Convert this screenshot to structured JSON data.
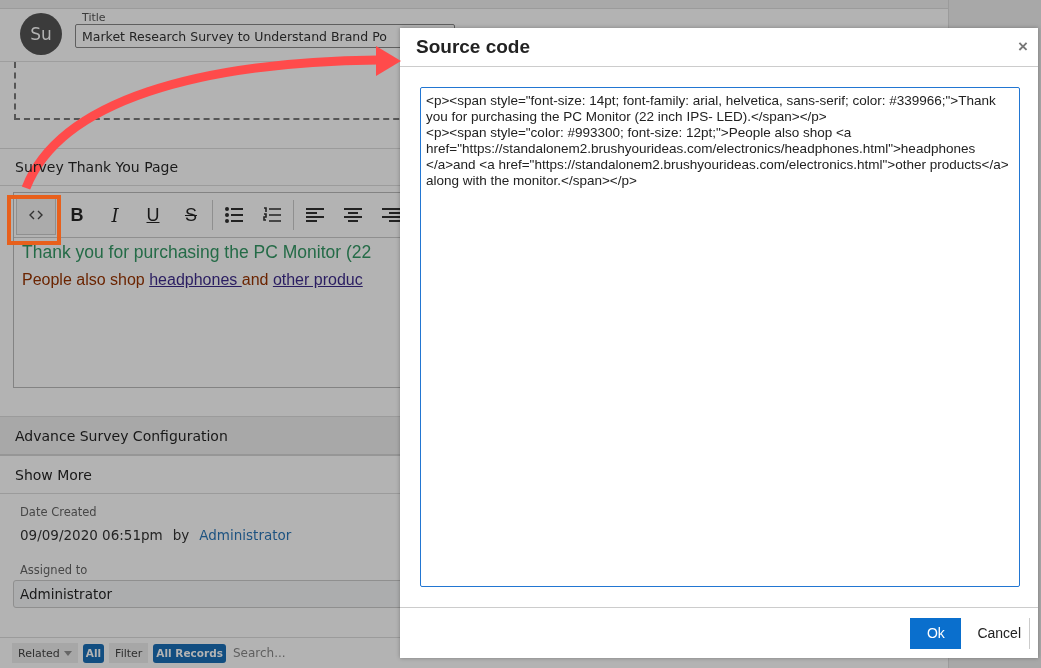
{
  "record": {
    "avatar": "Su",
    "title_label": "Title",
    "title_value": "Market Research Survey to Understand Brand Po"
  },
  "thank_you_section": {
    "heading": "Survey Thank You Page",
    "toolbar": [
      {
        "kind": "code",
        "selected": true
      },
      {
        "kind": "bold",
        "label": "B"
      },
      {
        "kind": "italic",
        "label": "I"
      },
      {
        "kind": "underline",
        "label": "U"
      },
      {
        "kind": "strike",
        "label": "S"
      },
      {
        "kind": "bullets"
      },
      {
        "kind": "numbers"
      },
      {
        "kind": "align-left"
      },
      {
        "kind": "align-center"
      },
      {
        "kind": "align-right"
      }
    ],
    "paragraphs": [
      {
        "color": "#246b47",
        "parts": [
          {
            "text": "Thank you for purchasing the PC Monitor (22",
            "kind": "text"
          }
        ]
      },
      {
        "color": "#6b2400",
        "parts": [
          {
            "text": "People also shop ",
            "kind": "text"
          },
          {
            "text": "headphones ",
            "kind": "link"
          },
          {
            "text": "and ",
            "kind": "text"
          },
          {
            "text": "other produc",
            "kind": "link"
          }
        ]
      }
    ]
  },
  "sections": [
    "Advance Survey Configuration",
    "Show More"
  ],
  "details": {
    "date_label": "Date Created",
    "date_value": "09/09/2020 06:51pm",
    "by": "by",
    "creator": "Administrator",
    "assigned_label": "Assigned to",
    "assigned_value": "Administrator"
  },
  "bottom_bar": {
    "related": "Related",
    "all": "All",
    "filter": "Filter",
    "all_records": "All Records",
    "search_placeholder": "Search..."
  },
  "dialog": {
    "title": "Source code",
    "close": "×",
    "code": "<p><span style=\"font-size: 14pt; font-family: arial, helvetica, sans-serif; color: #339966;\">Thank you for purchasing the PC Monitor (22 inch IPS- LED).</span></p>\n<p><span style=\"color: #993300; font-size: 12pt;\">People also shop <a href=\"https://standalonem2.brushyourideas.com/electronics/headphones.html\">headphones </a>and <a href=\"https://standalonem2.brushyourideas.com/electronics.html\">other products</a> along with the monitor.</span></p>",
    "buttons": [
      {
        "label": "Ok",
        "kind": "primary"
      },
      {
        "label": "Cancel",
        "kind": "plain"
      }
    ]
  }
}
